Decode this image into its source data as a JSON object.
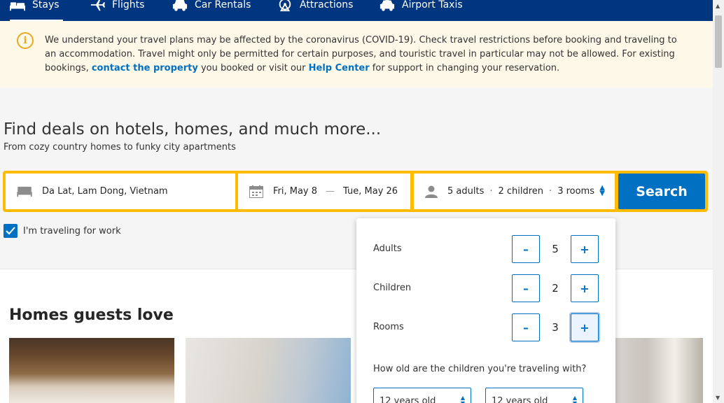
{
  "nav": {
    "items": [
      {
        "label": "Stays",
        "icon": "bed-icon",
        "active": true
      },
      {
        "label": "Flights",
        "icon": "plane-icon"
      },
      {
        "label": "Car Rentals",
        "icon": "car-icon"
      },
      {
        "label": "Attractions",
        "icon": "ferris-wheel-icon"
      },
      {
        "label": "Airport Taxis",
        "icon": "taxi-icon"
      }
    ]
  },
  "banner": {
    "icon": "info-icon",
    "text1": "We understand your travel plans may be affected by the coronavirus (COVID-19). Check travel restrictions before booking and traveling to an accommodation. Travel might only be permitted for certain purposes, and touristic travel in particular may not be allowed. For existing bookings, ",
    "link1": "contact the property",
    "text2": " you booked or visit our ",
    "link2": "Help Center",
    "text3": " for support in changing your reservation."
  },
  "hero": {
    "title": "Find deals on hotels, homes, and much more...",
    "subtitle": "From cozy country homes to funky city apartments"
  },
  "search": {
    "destination": "Da Lat, Lam Dong, Vietnam",
    "checkin": "Fri, May 8",
    "checkout": "Tue, May 26",
    "adults_summary": "5 adults",
    "children_summary": "2 children",
    "rooms_summary": "3 rooms",
    "search_label": "Search",
    "work_label": "I'm traveling for work"
  },
  "popup": {
    "adults_label": "Adults",
    "adults_value": "5",
    "children_label": "Children",
    "children_value": "2",
    "rooms_label": "Rooms",
    "rooms_value": "3",
    "minus": "–",
    "plus": "+",
    "children_question": "How old are the children you're traveling with?",
    "child_ages": [
      "12 years old",
      "12 years old"
    ]
  },
  "homes": {
    "title": "Homes guests love"
  },
  "colors": {
    "nav_bg": "#003580",
    "accent": "#0071c2",
    "search_border": "#febb02",
    "banner_bg": "#fef8e8"
  }
}
